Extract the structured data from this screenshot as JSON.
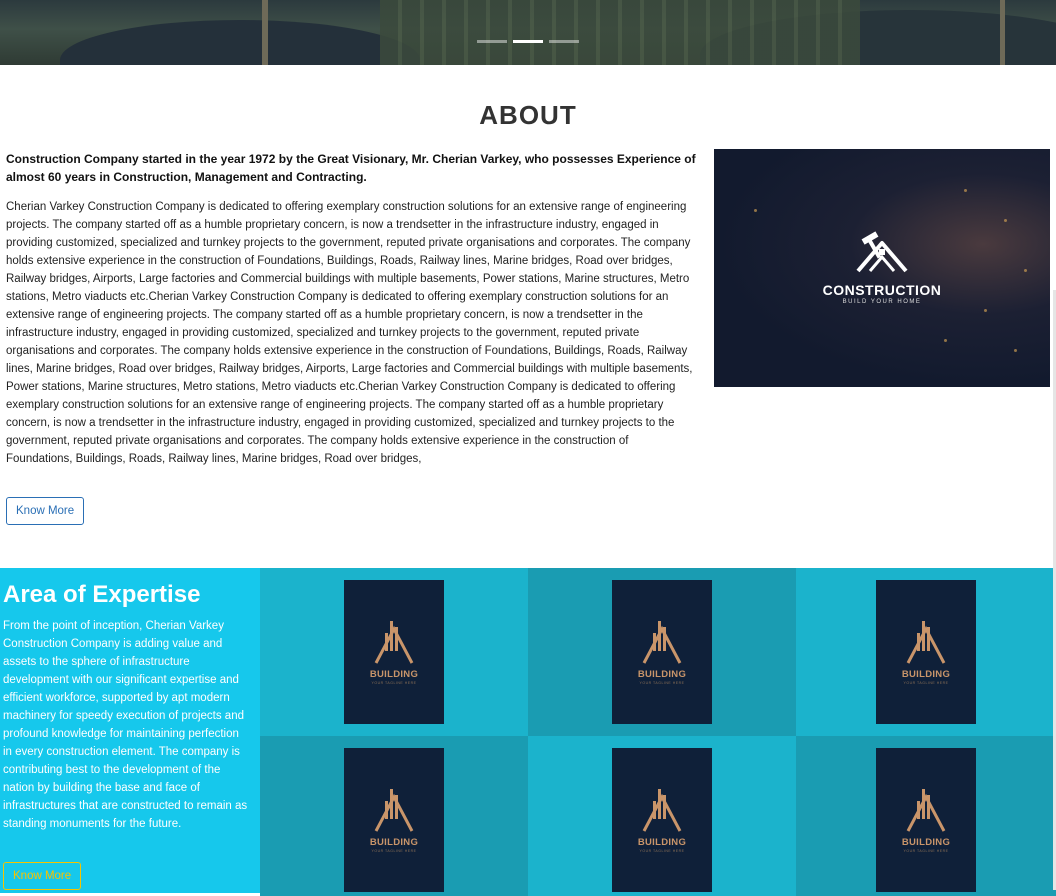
{
  "hero": {
    "slides": 3,
    "active_slide": 2
  },
  "about": {
    "title": "ABOUT",
    "lead": "Construction Company started in the year 1972 by the Great Visionary, Mr. Cherian Varkey, who possesses Experience of almost 60 years in Construction, Management and Contracting.",
    "body": "Cherian Varkey Construction Company is dedicated to offering exemplary construction solutions for an extensive range of engineering projects. The company started off as a humble proprietary concern, is now a trendsetter in the infrastructure industry, engaged in providing customized, specialized and turnkey projects to the government, reputed private organisations and corporates. The company holds extensive experience in the construction of Foundations, Buildings, Roads, Railway lines, Marine bridges, Road over bridges, Railway bridges, Airports, Large factories and Commercial buildings with multiple basements, Power stations, Marine structures, Metro stations, Metro viaducts etc.Cherian Varkey Construction Company is dedicated to offering exemplary construction solutions for an extensive range of engineering projects. The company started off as a humble proprietary concern, is now a trendsetter in the infrastructure industry, engaged in providing customized, specialized and turnkey projects to the government, reputed private organisations and corporates. The company holds extensive experience in the construction of Foundations, Buildings, Roads, Railway lines, Marine bridges, Road over bridges, Railway bridges, Airports, Large factories and Commercial buildings with multiple basements, Power stations, Marine structures, Metro stations, Metro viaducts etc.Cherian Varkey Construction Company is dedicated to offering exemplary construction solutions for an extensive range of engineering projects. The company started off as a humble proprietary concern, is now a trendsetter in the infrastructure industry, engaged in providing customized, specialized and turnkey projects to the government, reputed private organisations and corporates. The company holds extensive experience in the construction of Foundations, Buildings, Roads, Railway lines, Marine bridges, Road over bridges,",
    "button_label": "Know More",
    "image_logo_name": "CONSTRUCTION",
    "image_logo_tagline": "BUILD YOUR HOME"
  },
  "expertise": {
    "title": "Area of Expertise",
    "text": "From the point of inception, Cherian Varkey Construction Company is adding value and assets to the sphere of infrastructure development with our significant expertise and efficient workforce, supported by apt modern machinery for speedy execution of projects and profound knowledge for maintaining perfection in every construction element. The company is contributing best to the development of the nation by building the base and face of infrastructures that are constructed to remain as standing monuments for the future.",
    "button_label": "Know More",
    "tiles": [
      {
        "name": "BUILDING",
        "tagline": "YOUR TAGLINE HERE"
      },
      {
        "name": "BUILDING",
        "tagline": "YOUR TAGLINE HERE"
      },
      {
        "name": "BUILDING",
        "tagline": "YOUR TAGLINE HERE"
      },
      {
        "name": "BUILDING",
        "tagline": "YOUR TAGLINE HERE"
      },
      {
        "name": "BUILDING",
        "tagline": "YOUR TAGLINE HERE"
      },
      {
        "name": "BUILDING",
        "tagline": "YOUR TAGLINE HERE"
      }
    ]
  },
  "colors": {
    "accent_blue": "#2a6fb5",
    "expertise_bg": "#14c3e6",
    "button_yellow": "#f5c400",
    "card_navy": "#0f2039",
    "card_gold": "#c9956a"
  }
}
